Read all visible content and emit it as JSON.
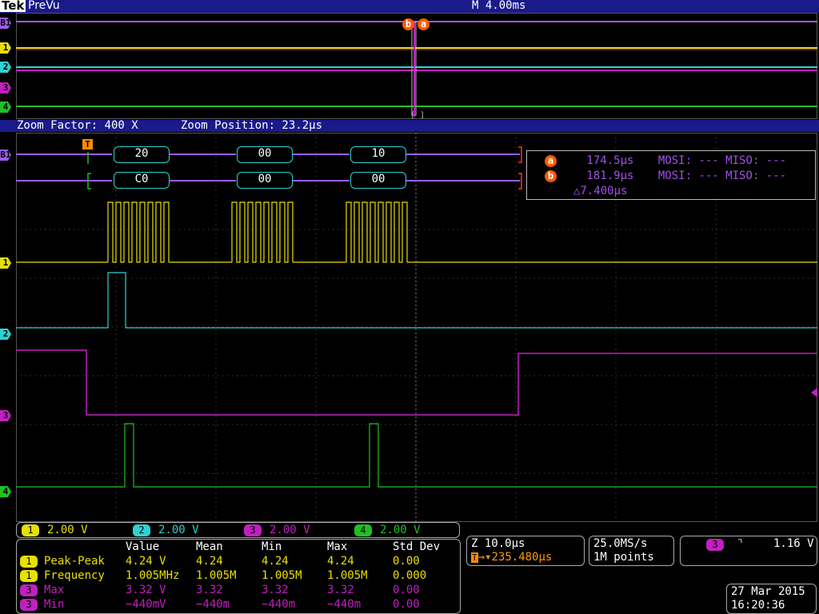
{
  "header": {
    "brand": "Tek",
    "mode": "PreVu",
    "timebase": "M 4.00ms"
  },
  "zoom": {
    "factor": "Zoom Factor: 400 X",
    "position": "Zoom Position: 23.2µs"
  },
  "channel_markers": {
    "b1": "B1",
    "ch1": "1",
    "ch2": "2",
    "ch3": "3",
    "ch4": "4"
  },
  "prevu_cursors": {
    "a": "a",
    "b": "b"
  },
  "bus": {
    "trigger_marker": "T",
    "mosi_values": [
      "20",
      "00",
      "10"
    ],
    "miso_values": [
      "C0",
      "00",
      "00"
    ]
  },
  "cursor_readout": {
    "a_label": "a",
    "a_time": "174.5µs",
    "a_text": "MOSI: --- MISO: ---",
    "b_label": "b",
    "b_time": "181.9µs",
    "b_text": "MOSI: --- MISO: ---",
    "delta": "△7.400µs"
  },
  "scales": [
    {
      "ch": "1",
      "value": "2.00 V",
      "color": "#e8e000"
    },
    {
      "ch": "2",
      "value": "2.00 V",
      "color": "#2fd1d1"
    },
    {
      "ch": "3",
      "value": "2.00 V",
      "color": "#c020c0"
    },
    {
      "ch": "4",
      "value": "2.00 V",
      "color": "#20c020"
    }
  ],
  "measurements": {
    "headers": [
      "Value",
      "Mean",
      "Min",
      "Max",
      "Std Dev"
    ],
    "rows": [
      {
        "ch": "1",
        "name": "Peak-Peak",
        "value": "4.24 V",
        "mean": "4.24",
        "min": "4.24",
        "max": "4.24",
        "std": "0.00",
        "color": "#e8e000"
      },
      {
        "ch": "1",
        "name": "Frequency",
        "value": "1.005MHz",
        "mean": "1.005M",
        "min": "1.005M",
        "max": "1.005M",
        "std": "0.000",
        "color": "#e8e000"
      },
      {
        "ch": "3",
        "name": "Max",
        "value": "3.32 V",
        "mean": "3.32",
        "min": "3.32",
        "max": "3.32",
        "std": "0.00",
        "color": "#c020c0"
      },
      {
        "ch": "3",
        "name": "Min",
        "value": "−440mV",
        "mean": "−440m",
        "min": "−440m",
        "max": "−440m",
        "std": "0.00",
        "color": "#c020c0"
      }
    ]
  },
  "horizontal": {
    "zoom": "Z 10.0µs",
    "trigger_pos": "235.480µs",
    "trigger_symbol": "T",
    "arrow": "→▾"
  },
  "acquisition": {
    "rate": "25.0MS/s",
    "points": "1M points"
  },
  "trigger": {
    "ch": "3",
    "slope": "⌝",
    "level": "1.16 V"
  },
  "datetime": {
    "date": "27 Mar 2015",
    "time": "16:20:36"
  },
  "colors": {
    "ch1": "#e8e000",
    "ch2": "#2fd1d1",
    "ch3": "#c020c0",
    "ch4": "#20c020",
    "bus": "#9b5de8",
    "cursor": "#ff5a00"
  }
}
